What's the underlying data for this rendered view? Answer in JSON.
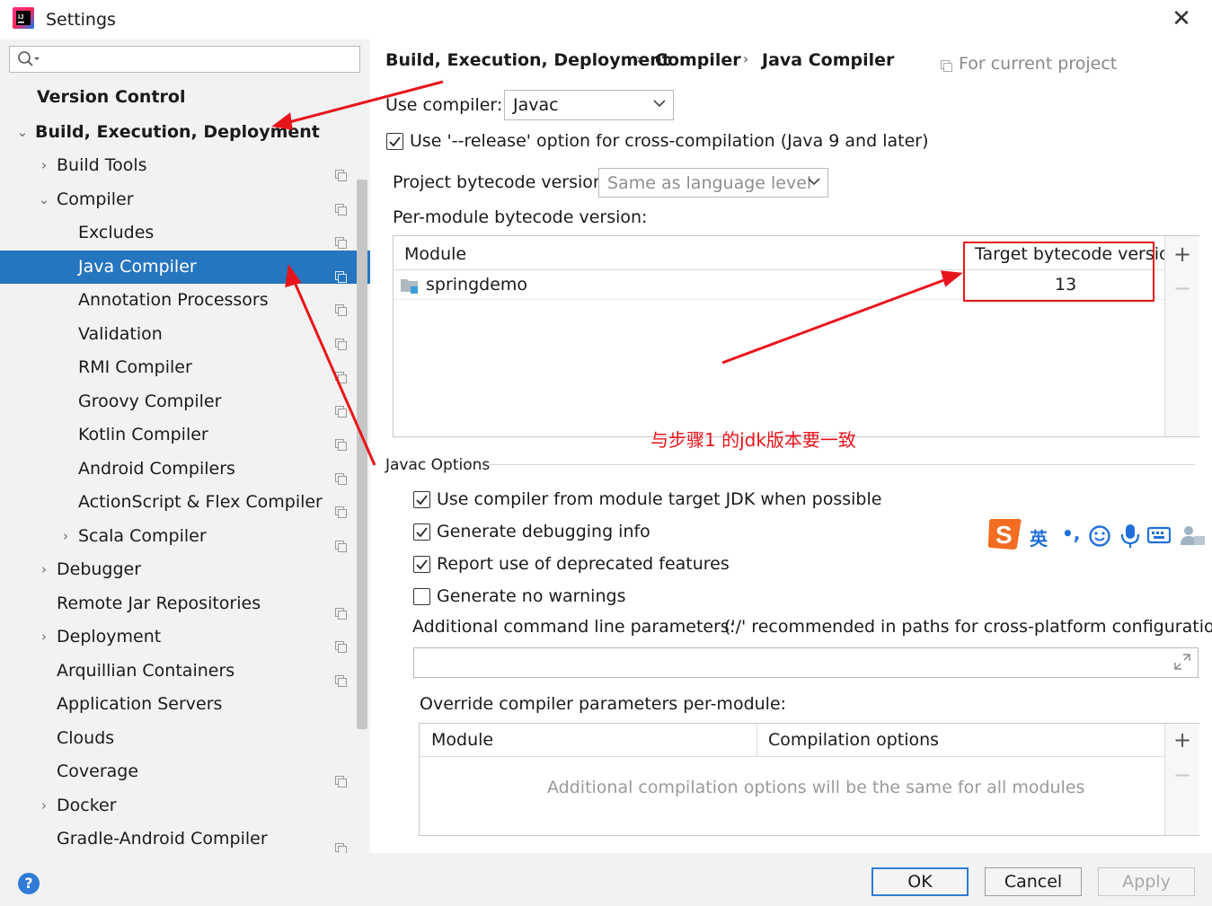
{
  "window": {
    "title": "Settings",
    "app_icon": "intellij-idea-icon",
    "close_icon": "close-icon"
  },
  "sidebar": {
    "search_placeholder": "",
    "items": [
      {
        "label": "Version Control"
      },
      {
        "label": "Build, Execution, Deployment"
      },
      {
        "label": "Build Tools"
      },
      {
        "label": "Compiler"
      },
      {
        "label": "Excludes"
      },
      {
        "label": "Java Compiler"
      },
      {
        "label": "Annotation Processors"
      },
      {
        "label": "Validation"
      },
      {
        "label": "RMI Compiler"
      },
      {
        "label": "Groovy Compiler"
      },
      {
        "label": "Kotlin Compiler"
      },
      {
        "label": "Android Compilers"
      },
      {
        "label": "ActionScript & Flex Compiler"
      },
      {
        "label": "Scala Compiler"
      },
      {
        "label": "Debugger"
      },
      {
        "label": "Remote Jar Repositories"
      },
      {
        "label": "Deployment"
      },
      {
        "label": "Arquillian Containers"
      },
      {
        "label": "Application Servers"
      },
      {
        "label": "Clouds"
      },
      {
        "label": "Coverage"
      },
      {
        "label": "Docker"
      },
      {
        "label": "Gradle-Android Compiler"
      }
    ]
  },
  "breadcrumb": {
    "part1": "Build, Execution, Deployment",
    "part2": "Compiler",
    "part3": "Java Compiler",
    "sep": "›"
  },
  "for_current_project": "For current project",
  "compiler": {
    "use_compiler_label": "Use compiler:",
    "use_compiler_value": "Javac",
    "release_option_label": "Use '--release' option for cross-compilation (Java 9 and later)",
    "release_option_checked": true,
    "project_bytecode_label": "Project bytecode version:",
    "project_bytecode_value": "Same as language level",
    "per_module_label": "Per-module bytecode version:"
  },
  "module_table": {
    "col_module": "Module",
    "col_target": "Target bytecode version",
    "rows": [
      {
        "module": "springdemo",
        "target": "13"
      }
    ]
  },
  "annotation": {
    "note": "与步骤1 的jdk版本要一致"
  },
  "javac_options": {
    "section_title": "Javac Options",
    "opt1": "Use compiler from module target JDK when possible",
    "opt2": "Generate debugging info",
    "opt3": "Report use of deprecated features",
    "opt4": "Generate no warnings",
    "opt1_checked": true,
    "opt2_checked": true,
    "opt3_checked": true,
    "opt4_checked": false,
    "cmd_params_label": "Additional command line parameters:",
    "cmd_params_hint": "('/' recommended in paths for cross-platform configurations)",
    "cmd_params_value": ""
  },
  "ime_toolbar": {
    "lang": "英",
    "punct": "•,"
  },
  "override_table": {
    "title": "Override compiler parameters per-module:",
    "col_module": "Module",
    "col_options": "Compilation options",
    "empty_text": "Additional compilation options will be the same for all modules"
  },
  "buttons": {
    "ok": "OK",
    "cancel": "Cancel",
    "apply": "Apply",
    "help": "?"
  },
  "colors": {
    "selection": "#2675bf",
    "annotation_red": "#e8141b",
    "accent": "#2f7bd6"
  }
}
